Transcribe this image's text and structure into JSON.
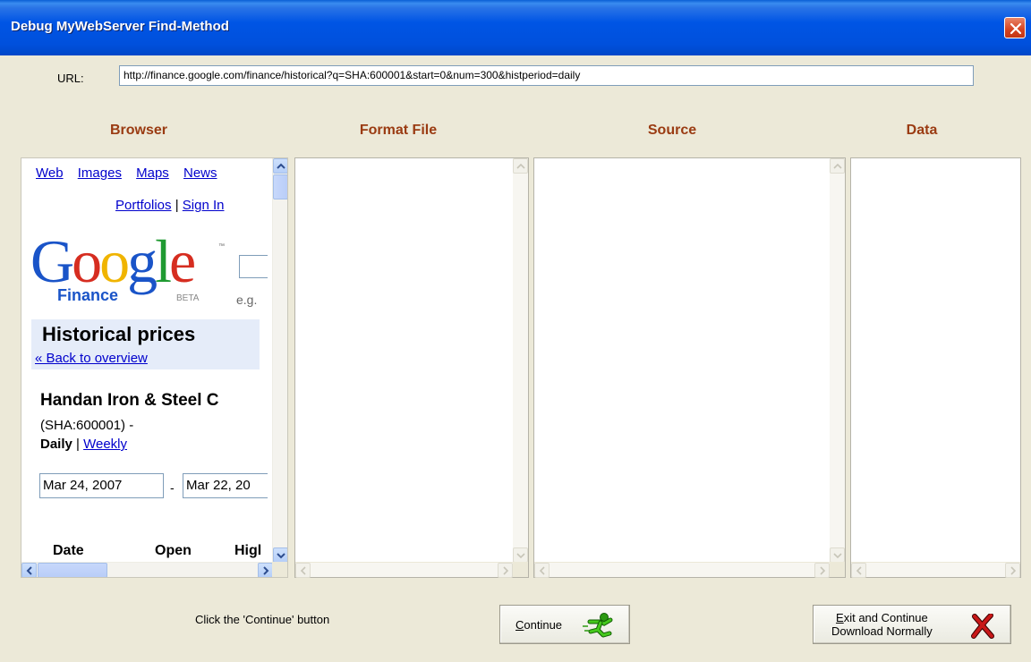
{
  "window": {
    "title": "Debug MyWebServer Find-Method"
  },
  "url": {
    "label": "URL:",
    "value": "http://finance.google.com/finance/historical?q=SHA:600001&start=0&num=300&histperiod=daily"
  },
  "columns": {
    "browser": "Browser",
    "format_file": "Format File",
    "source": "Source",
    "data": "Data"
  },
  "browser_page": {
    "nav": [
      "Web",
      "Images",
      "Maps",
      "News"
    ],
    "portfolios": "Portfolios",
    "separator": "|",
    "sign_in": "Sign In",
    "logo_text": "Google",
    "logo_tm": "™",
    "logo_finance": "Finance",
    "logo_beta": "BETA",
    "search_hint": "e.g.",
    "section_title": "Historical prices",
    "back_link": "« Back to overview",
    "company": "Handan Iron & Steel C",
    "ticker": "(SHA:600001) -",
    "period_daily": "Daily",
    "period_sep": " | ",
    "period_weekly": "Weekly",
    "start_date": "Mar 24, 2007",
    "date_sep": "-",
    "end_date": "Mar 22, 20",
    "table_headers": [
      "Date",
      "Open",
      "Higl"
    ]
  },
  "status": {
    "text": "Click the 'Continue' button"
  },
  "buttons": {
    "continue_accel": "C",
    "continue_rest": "ontinue",
    "exit_accel": "E",
    "exit_line1_rest": "xit and Continue",
    "exit_line2": "Download Normally"
  },
  "colors": {
    "title_bar": "#0055e5",
    "column_header": "#9a3b12",
    "link": "#0000cc",
    "window_bg": "#ece9d8"
  }
}
